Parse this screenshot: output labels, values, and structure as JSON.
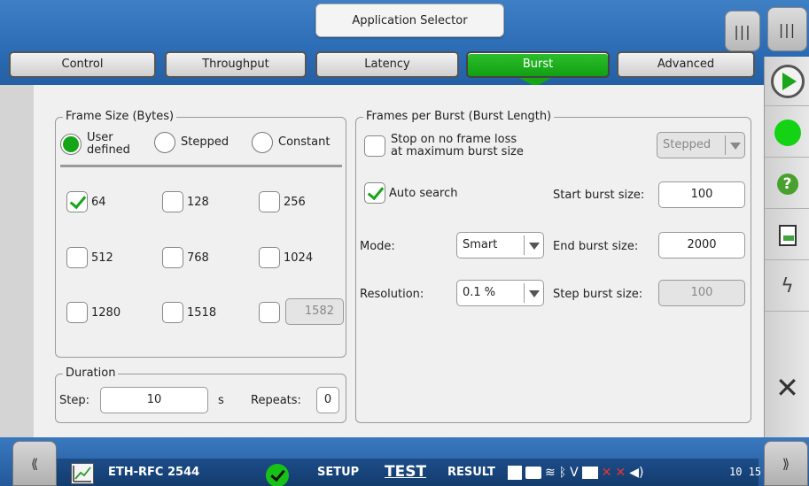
{
  "header": {
    "app_selector": "Application Selector",
    "tabs": [
      {
        "label": "Control"
      },
      {
        "label": "Throughput"
      },
      {
        "label": "Latency"
      },
      {
        "label": "Burst"
      },
      {
        "label": "Advanced"
      }
    ],
    "active_tab": "Burst"
  },
  "frame_size": {
    "title": "Frame Size (Bytes)",
    "modes": [
      "User defined",
      "Stepped",
      "Constant"
    ],
    "mode_line1": "User",
    "mode_line2": "defined",
    "selected_mode": "User defined",
    "sizes": [
      {
        "label": "64",
        "checked": true
      },
      {
        "label": "128",
        "checked": false
      },
      {
        "label": "256",
        "checked": false
      },
      {
        "label": "512",
        "checked": false
      },
      {
        "label": "768",
        "checked": false
      },
      {
        "label": "1024",
        "checked": false
      },
      {
        "label": "1280",
        "checked": false
      },
      {
        "label": "1518",
        "checked": false
      }
    ],
    "custom_size_value": "1582",
    "custom_size_checked": false
  },
  "duration": {
    "title": "Duration",
    "step_label": "Step:",
    "step_value": "10",
    "step_unit": "s",
    "repeats_label": "Repeats:",
    "repeats_value": "0"
  },
  "burst": {
    "title": "Frames per Burst (Burst Length)",
    "stop_label_line1": "Stop on no frame loss",
    "stop_label_line2": "at maximum burst size",
    "stop_checked": false,
    "stop_select": "Stepped",
    "auto_search_label": "Auto search",
    "auto_search_checked": true,
    "mode_label": "Mode:",
    "mode_value": "Smart",
    "resolution_label": "Resolution:",
    "resolution_value": "0.1 %",
    "start_label": "Start burst size:",
    "start_value": "100",
    "end_label": "End burst size:",
    "end_value": "2000",
    "step_label": "Step burst size:",
    "step_value": "100"
  },
  "status_bar": {
    "module": "ETH-RFC 2544",
    "setup": "SETUP",
    "test": "TEST",
    "result": "RESULT",
    "clock": "10 15"
  },
  "colors": {
    "accent_green": "#16a516",
    "top_blue": "#2b6cb5"
  }
}
